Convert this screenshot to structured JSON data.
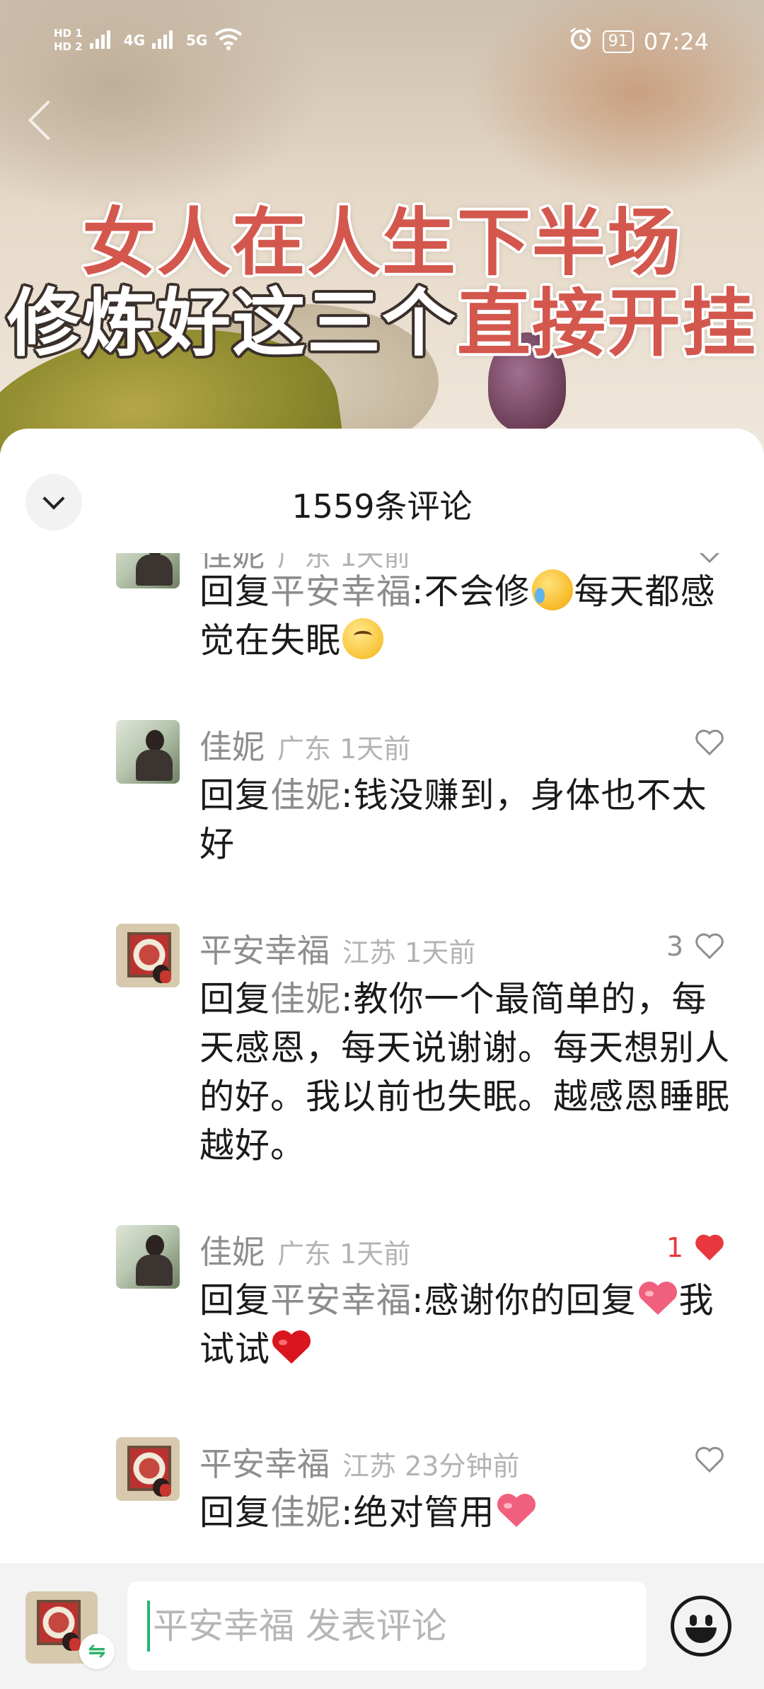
{
  "status_bar": {
    "hd1": "HD 1",
    "hd2": "HD 2",
    "signal1": "4G",
    "signal2": "5G",
    "battery": "91",
    "time": "07:24",
    "icons": [
      "signal-icon",
      "wifi-icon",
      "alarm-icon",
      "battery-icon"
    ]
  },
  "video": {
    "title_line1": "女人在人生下半场",
    "title_line2_a": "修炼好这三个",
    "title_line2_b": "直接开挂"
  },
  "comments_panel": {
    "title": "1559条评论",
    "comments": [
      {
        "name": "佳妮",
        "meta": "广东 1天前",
        "reply_prefix": "回复",
        "reply_to": "平安幸福",
        "text_a": ":不会修",
        "text_b": "每天都感觉在失眠",
        "likes": "",
        "liked": false,
        "emojis": [
          "crying-emoji",
          "woozy-emoji"
        ]
      },
      {
        "name": "佳妮",
        "meta": "广东 1天前",
        "reply_prefix": "回复",
        "reply_to": "佳妮",
        "text": ":钱没赚到，身体也不太好",
        "likes": "",
        "liked": false
      },
      {
        "name": "平安幸福",
        "meta": "江苏 1天前",
        "reply_prefix": "回复",
        "reply_to": "佳妮",
        "text": ":教你一个最简单的，每天感恩，每天说谢谢。每天想别人的好。我以前也失眠。越感恩睡眠越好。",
        "likes": "3",
        "liked": false
      },
      {
        "name": "佳妮",
        "meta": "广东 1天前",
        "reply_prefix": "回复",
        "reply_to": "平安幸福",
        "text_a": ":感谢你的回复",
        "text_b": "我试试",
        "likes": "1",
        "liked": true,
        "emojis": [
          "pink-heart-emoji",
          "red-heart-emoji"
        ]
      },
      {
        "name": "平安幸福",
        "meta": "江苏 23分钟前",
        "reply_prefix": "回复",
        "reply_to": "佳妮",
        "text": ":绝对管用",
        "likes": "",
        "liked": false,
        "emojis": [
          "pink-heart-emoji"
        ]
      }
    ]
  },
  "input_bar": {
    "placeholder": "平安幸福 发表评论",
    "switch_glyph": "⇋"
  },
  "colors": {
    "liked": "#e8383d",
    "caret": "#22b573",
    "name_gray": "#8e8e8e",
    "title_red": "#d3574d"
  }
}
